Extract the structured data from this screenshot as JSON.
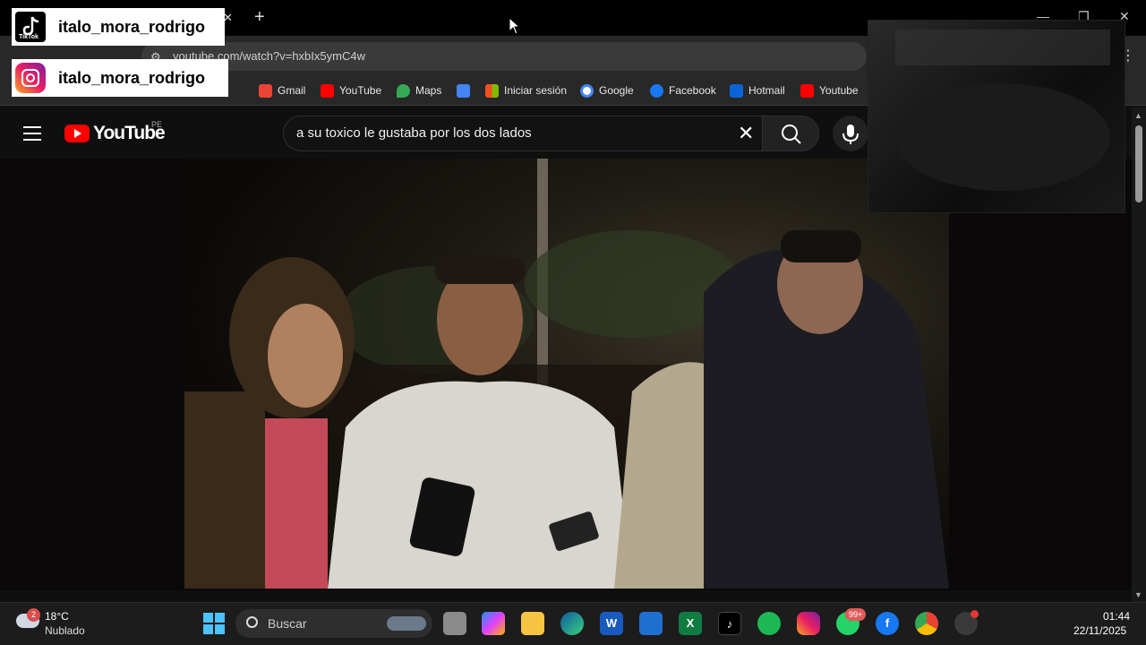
{
  "browser": {
    "url": "youtube.com/watch?v=hxbIx5ymC4w",
    "bookmarks": [
      {
        "label": "Gmail",
        "icon": "gmail-icon",
        "color": "#ea4335"
      },
      {
        "label": "YouTube",
        "icon": "youtube-icon",
        "color": "#ff0000"
      },
      {
        "label": "Maps",
        "icon": "maps-icon",
        "color": "#34a853"
      },
      {
        "label": "Iniciar sesión",
        "icon": "microsoft-icon",
        "color": "#f25022"
      },
      {
        "label": "Google",
        "icon": "google-icon",
        "color": "#4285f4"
      },
      {
        "label": "Facebook",
        "icon": "facebook-icon",
        "color": "#1877f2"
      },
      {
        "label": "Hotmail",
        "icon": "outlook-icon",
        "color": "#0a64d8"
      },
      {
        "label": "Youtube",
        "icon": "youtube-icon",
        "color": "#ff0000"
      }
    ]
  },
  "youtube": {
    "wordmark": "YouTube",
    "region": "PE",
    "search_query": "a su toxico le gustaba por los dos lados"
  },
  "overlay": {
    "tiktok_label": "TikTok",
    "tiktok_handle": "italo_mora_rodrigo",
    "instagram_handle": "italo_mora_rodrigo"
  },
  "taskbar": {
    "weather_badge": "2",
    "temperature": "18°C",
    "condition": "Nublado",
    "search_placeholder": "Buscar",
    "whatsapp_badge": "99+",
    "time": "01:44",
    "date": "22/11/2025"
  }
}
